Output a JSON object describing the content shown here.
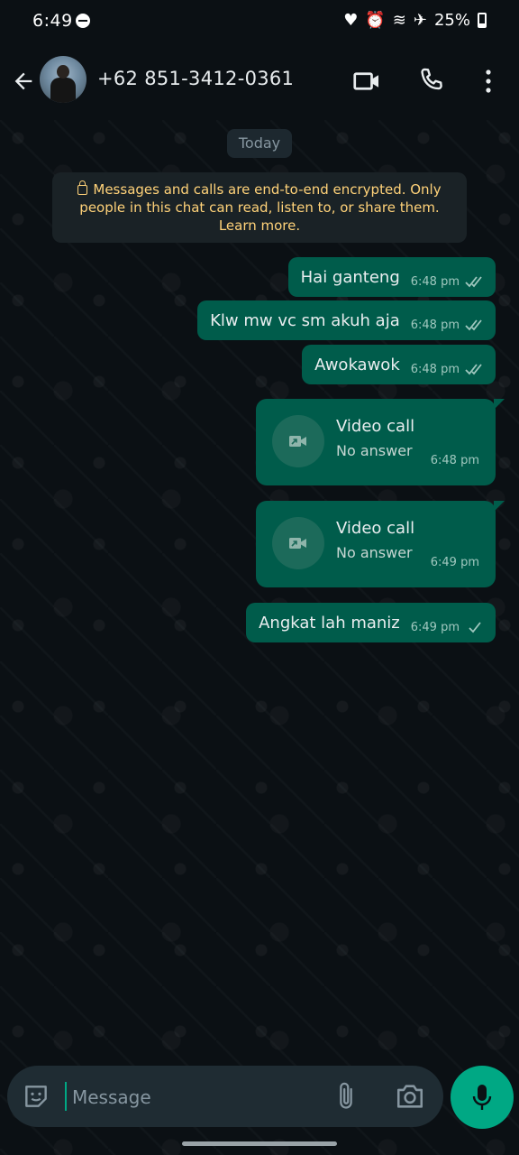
{
  "status_bar": {
    "time": "6:49",
    "battery": "25%"
  },
  "header": {
    "contact": "+62 851-3412-0361"
  },
  "chat": {
    "date_chip": "Today",
    "encryption_notice": "Messages and calls are end-to-end encrypted. Only people in this chat can read, listen to, or share them. Learn more.",
    "messages": [
      {
        "text": "Hai ganteng",
        "time": "6:48 pm",
        "status": "read"
      },
      {
        "text": "Klw mw vc sm akuh aja",
        "time": "6:48 pm",
        "status": "read"
      },
      {
        "text": "Awokawok",
        "time": "6:48 pm",
        "status": "read"
      }
    ],
    "calls": [
      {
        "title": "Video call",
        "subtitle": "No answer",
        "time": "6:48 pm"
      },
      {
        "title": "Video call",
        "subtitle": "No answer",
        "time": "6:49 pm"
      }
    ],
    "last_message": {
      "text": "Angkat lah maniz",
      "time": "6:49 pm",
      "status": "sent"
    }
  },
  "composer": {
    "placeholder": "Message"
  },
  "colors": {
    "bubble_out": "#005c4b",
    "accent": "#00a884",
    "notice_text": "#ffd279",
    "background": "#0b1014"
  },
  "icons": [
    "back-arrow-icon",
    "video-call-icon",
    "phone-icon",
    "more-vert-icon",
    "emoji-sticker-icon",
    "paperclip-icon",
    "camera-icon",
    "mic-icon",
    "double-check-icon",
    "single-check-icon"
  ]
}
